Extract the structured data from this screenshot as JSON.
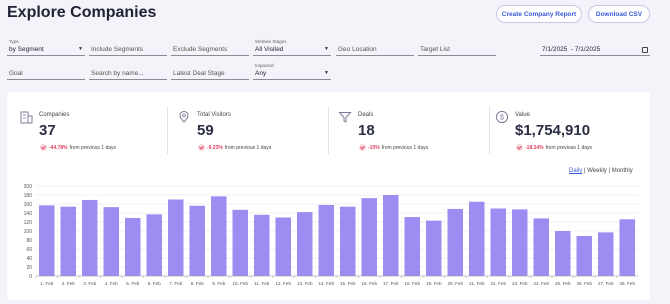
{
  "header": {
    "title": "Explore Companies",
    "create_report": "Create Company Report",
    "download_csv": "Download CSV"
  },
  "filters": {
    "type": {
      "label": "Type",
      "value": "by Segment"
    },
    "include_segments": "Include Segments",
    "exclude_segments": "Exclude Segments",
    "website_stages": {
      "label": "Website Stages",
      "value": "All Visited"
    },
    "geo_location": "Geo Location",
    "target_list": "Target List",
    "date_range": "7/1/2025  - 7/1/2025",
    "goal": "Goal",
    "search": "Search by name...",
    "latest_deal_stage": "Latest Deal Stage",
    "impacted": {
      "label": "Impacted",
      "value": "Any"
    }
  },
  "stats": [
    {
      "label": "Companies",
      "value": "37",
      "change": "-44.78%",
      "suffix": "from previous 1 days",
      "icon": "building-icon"
    },
    {
      "label": "Total Visitors",
      "value": "59",
      "change": "-9.23%",
      "suffix": "from previous 1 days",
      "icon": "location-pin-icon"
    },
    {
      "label": "Deals",
      "value": "18",
      "change": "-10%",
      "suffix": "from previous 1 days",
      "icon": "funnel-icon"
    },
    {
      "label": "Value",
      "value": "$1,754,910",
      "change": "-18.34%",
      "suffix": "from previous 1 days",
      "icon": "dollar-icon"
    }
  ],
  "period": {
    "daily": "Daily",
    "weekly": "Weekly",
    "monthly": "Monthly",
    "sep": "|",
    "active": "daily"
  },
  "colors": {
    "bar": "#9d8cf2",
    "accent": "#3b5bdb",
    "negative": "#e0405e"
  },
  "chart_data": {
    "type": "bar",
    "categories": [
      "1. Feb",
      "2. Feb",
      "3. Feb",
      "4. Feb",
      "5. Feb",
      "6. Feb",
      "7. Feb",
      "8. Feb",
      "9. Feb",
      "10. Feb",
      "11. Feb",
      "12. Feb",
      "13. Feb",
      "14. Feb",
      "15. Feb",
      "16. Feb",
      "17. Feb",
      "18. Feb",
      "19. Feb",
      "20. Feb",
      "21. Feb",
      "22. Feb",
      "23. Feb",
      "24. Feb",
      "25. Feb",
      "26. Feb",
      "27. Feb",
      "28. Feb"
    ],
    "values": [
      157,
      154,
      169,
      153,
      129,
      137,
      170,
      156,
      177,
      147,
      136,
      130,
      142,
      158,
      154,
      173,
      180,
      131,
      123,
      149,
      165,
      150,
      148,
      128,
      100,
      89,
      97,
      126
    ],
    "ylim": [
      0,
      200
    ],
    "yticks": [
      0,
      20,
      40,
      60,
      80,
      100,
      120,
      140,
      160,
      180,
      200
    ],
    "grid": true
  }
}
